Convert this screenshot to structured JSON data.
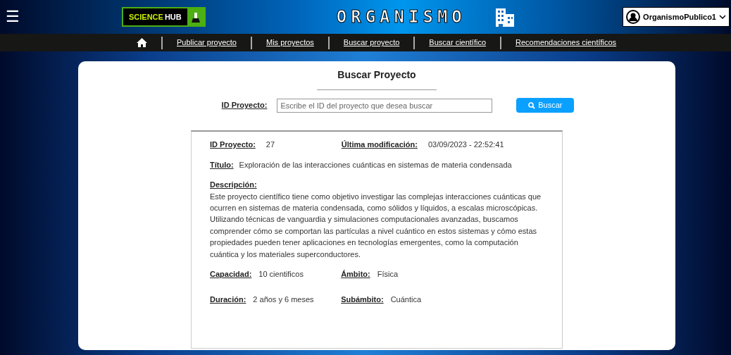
{
  "header": {
    "menu_icon": "☰",
    "logo": {
      "word_1": "SCIENCE",
      "word_2": "HUB"
    },
    "title": "ORGANISMO",
    "user": "OrganismoPublico1"
  },
  "nav": {
    "links": [
      "Publicar proyecto",
      "Mis proyectos",
      "Buscar proyecto",
      "Buscar científico",
      "Recomendaciones científicos"
    ]
  },
  "search": {
    "heading": "Buscar Proyecto",
    "label": "ID Proyecto:",
    "placeholder": "Escribe el ID del proyecto que desea buscar",
    "button": "Buscar"
  },
  "result": {
    "top_row": [
      {
        "label": "ID Proyecto:",
        "value": "27"
      },
      {
        "label": "Última modificación:",
        "value": "03/09/2023 - 22:52:41"
      }
    ],
    "title": {
      "label": "Título:",
      "value": "Exploración de las interacciones cuánticas en sistemas de materia condensada"
    },
    "description": {
      "label": "Descripción:",
      "value": "Este proyecto científico tiene como objetivo investigar las complejas interacciones cuánticas que ocurren en sistemas de materia condensada, como sólidos y líquidos, a escalas microscópicas. Utilizando técnicas de vanguardia y simulaciones computacionales avanzadas, buscamos comprender cómo se comportan las partículas a nivel cuántico en estos sistemas y cómo estas propiedades pueden tener aplicaciones en tecnologías emergentes, como la computación cuántica y los materiales superconductores."
    },
    "bottom_rows": [
      [
        {
          "label": "Capacidad:",
          "value": "10 cientificos"
        },
        {
          "label": "Ámbito:",
          "value": "Física"
        }
      ],
      [
        {
          "label": "Duración:",
          "value": "2 años y 6 meses"
        },
        {
          "label": "Subámbito:",
          "value": "Cuántica"
        }
      ]
    ]
  }
}
